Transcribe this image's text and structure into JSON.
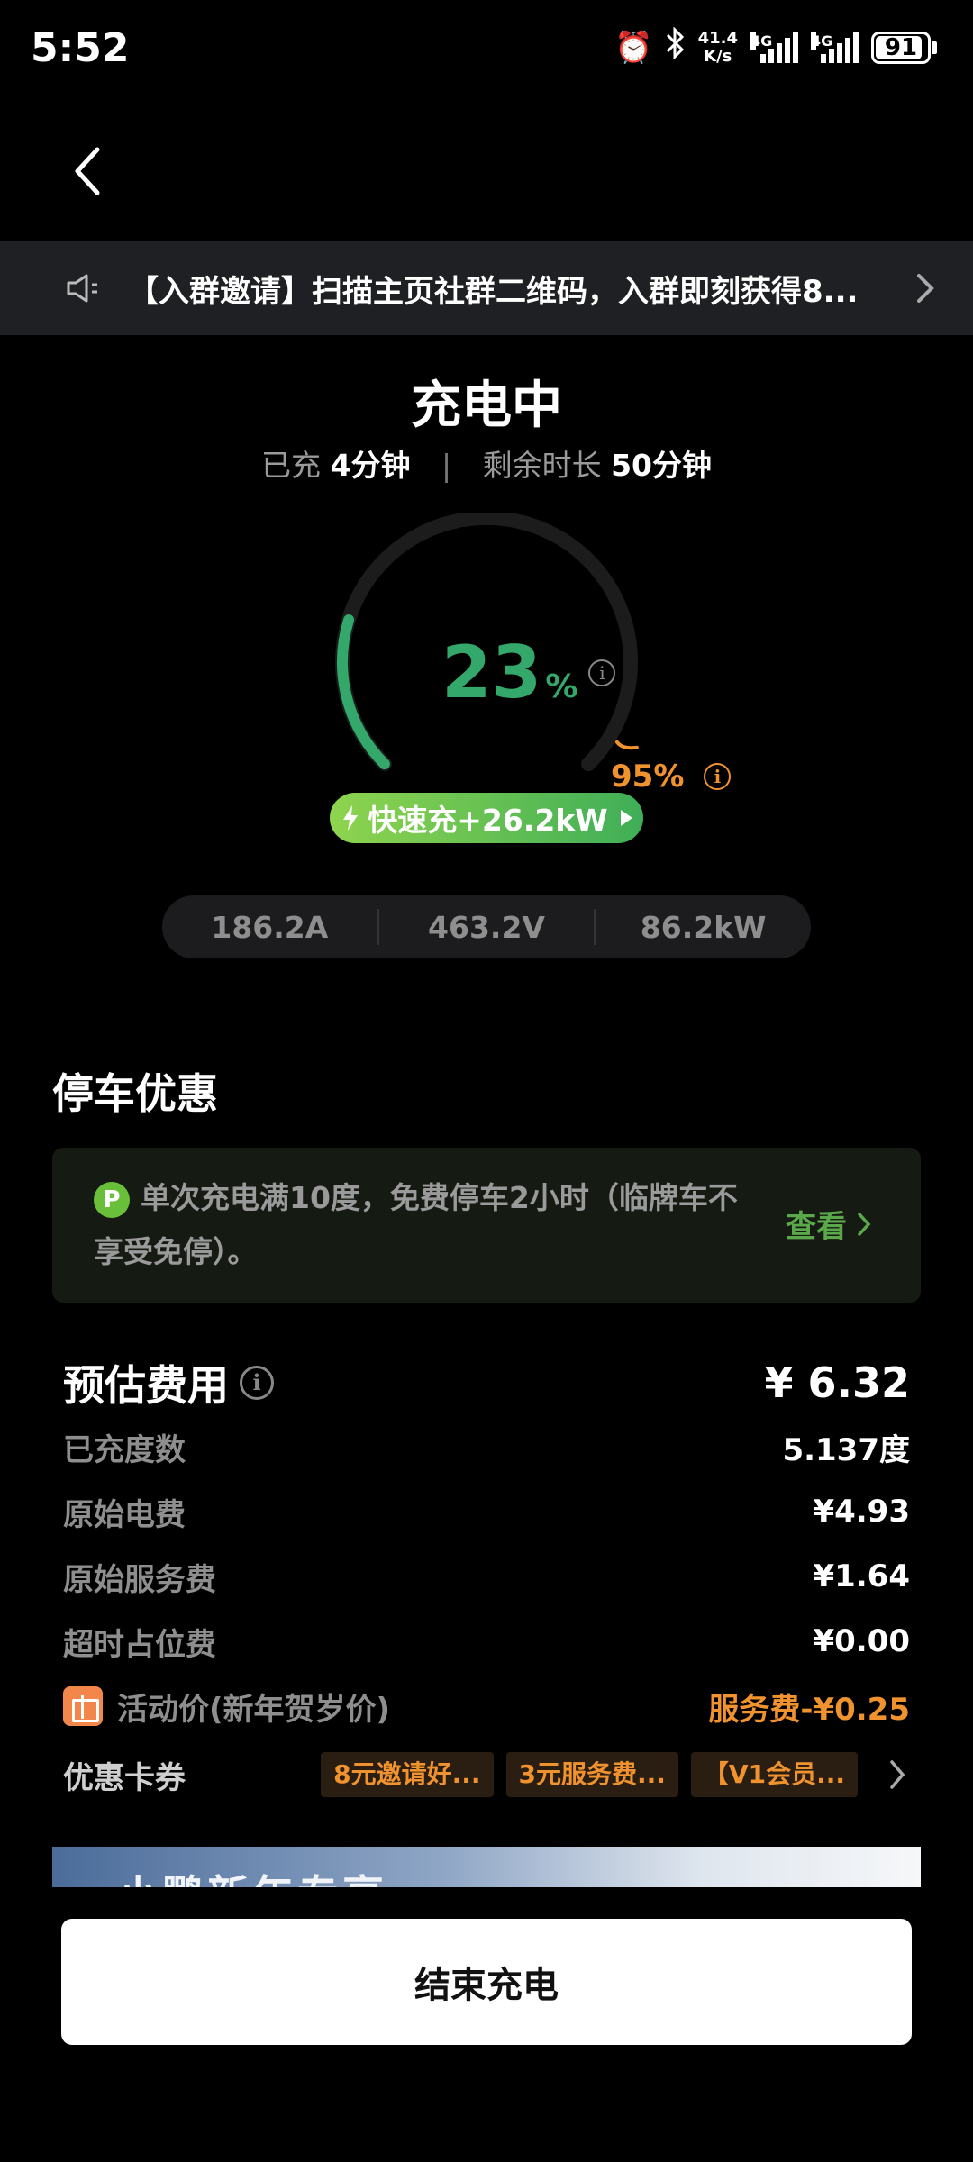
{
  "status_bar": {
    "time": "5:52",
    "net_speed_value": "41.4",
    "net_speed_unit": "K/s",
    "signal1_label": "4G",
    "signal2_label": "4G",
    "battery": "91",
    "battery_level": 0.91
  },
  "notice": {
    "text": "【入群邀请】扫描主页社群二维码，入群即刻获得8..."
  },
  "charging": {
    "title": "充电中",
    "charged_label": "已充",
    "charged_value": "4分钟",
    "remaining_label": "剩余时长",
    "remaining_value": "50分钟",
    "percent": "23",
    "percent_symbol": "%",
    "percent_value": 23,
    "target": "95%",
    "target_value": 95,
    "fast_label": "快速充+26.2kW",
    "metrics": [
      "186.2A",
      "463.2V",
      "86.2kW"
    ]
  },
  "parking": {
    "title": "停车优惠",
    "badge": "P",
    "text": "单次充电满10度，免费停车2小时（临牌车不享受免停）。",
    "link": "查看"
  },
  "fees": {
    "title": "预估费用",
    "total": "¥ 6.32",
    "rows": [
      {
        "label": "已充度数",
        "value": "5.137度"
      },
      {
        "label": "原始电费",
        "value": "¥4.93"
      },
      {
        "label": "原始服务费",
        "value": "¥1.64"
      },
      {
        "label": "超时占位费",
        "value": "¥0.00"
      }
    ],
    "promo_label": "活动价(新年贺岁价)",
    "promo_value": "服务费-¥0.25",
    "coupon_label": "优惠卡券",
    "coupons": [
      "8元邀请好...",
      "3元服务费...",
      "【V1会员..."
    ]
  },
  "banner": {
    "text": "小鹏新年专享"
  },
  "end_button": "结束充电",
  "colors": {
    "accent_green": "#34a86b",
    "orange": "#f0922e",
    "background": "#000000"
  }
}
